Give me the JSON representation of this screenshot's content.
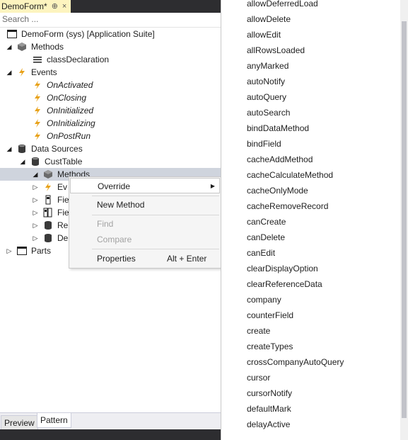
{
  "tab": {
    "title": "DemoForm*",
    "pin": "⊕",
    "close": "×"
  },
  "search": {
    "placeholder": "Search ..."
  },
  "tree": {
    "root": "DemoForm (sys) [Application Suite]",
    "methods": "Methods",
    "class_declaration": "classDeclaration",
    "events": "Events",
    "event_items": [
      "OnActivated",
      "OnClosing",
      "OnInitialized",
      "OnInitializing",
      "OnPostRun"
    ],
    "data_sources": "Data Sources",
    "cust_table": "CustTable",
    "ds_methods": "Methods",
    "ds_events": "Ev",
    "ds_fields": "Fie",
    "ds_field_groups": "Fie",
    "ds_ranges": "Re",
    "ds_derived": "De",
    "parts": "Parts"
  },
  "context_menu": {
    "override": "Override",
    "new_method": "New Method",
    "find": "Find",
    "compare": "Compare",
    "properties": "Properties",
    "properties_shortcut": "Alt + Enter"
  },
  "override_menu": [
    "allowDeferredLoad",
    "allowDelete",
    "allowEdit",
    "allRowsLoaded",
    "anyMarked",
    "autoNotify",
    "autoQuery",
    "autoSearch",
    "bindDataMethod",
    "bindField",
    "cacheAddMethod",
    "cacheCalculateMethod",
    "cacheOnlyMode",
    "cacheRemoveRecord",
    "canCreate",
    "canDelete",
    "canEdit",
    "clearDisplayOption",
    "clearReferenceData",
    "company",
    "counterField",
    "create",
    "createTypes",
    "crossCompanyAutoQuery",
    "cursor",
    "cursorNotify",
    "defaultMark",
    "delayActive"
  ],
  "bottom_tabs": {
    "preview": "Preview",
    "pattern": "Pattern"
  },
  "colors": {
    "tab_bg": "#fdf4bf",
    "dark_chrome": "#2d2d30",
    "event_icon": "#e8a21a",
    "selection": "#cfd4dd"
  }
}
